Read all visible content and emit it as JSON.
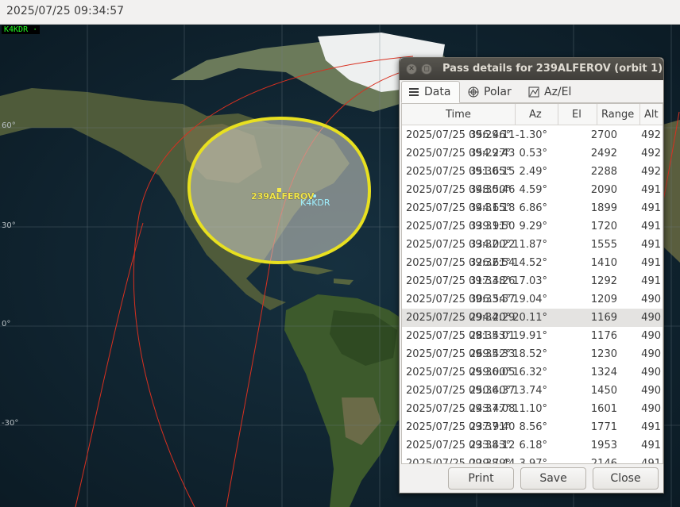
{
  "clock": "2025/07/25 09:34:57",
  "map": {
    "qth_badge": "K4KDR ·",
    "lat_labels": [
      "60°",
      "30°",
      "0°",
      "-30°"
    ],
    "satellite_label": "239ALFEROV",
    "qth_label": "K4KDR",
    "footprint_color": "#e8e020",
    "track_color": "#d83020"
  },
  "dialog": {
    "title": "Pass details for 239ALFEROV (orbit 1)",
    "tabs": [
      {
        "label": "Data",
        "icon": "list-icon"
      },
      {
        "label": "Polar",
        "icon": "polar-icon"
      },
      {
        "label": "Az/El",
        "icon": "chart-icon"
      }
    ],
    "columns": [
      "Time",
      "Az",
      "El",
      "Range",
      "Alt"
    ],
    "rows": [
      [
        "2025/07/25 09:29:11",
        "356.46°",
        "-1.30°",
        "2700",
        "492"
      ],
      [
        "2025/07/25 09:29:43",
        "354.27°",
        "0.53°",
        "2492",
        "492"
      ],
      [
        "2025/07/25 09:30:15",
        "351.65°",
        "2.49°",
        "2288",
        "492"
      ],
      [
        "2025/07/25 09:30:46",
        "348.50°",
        "4.59°",
        "2090",
        "491"
      ],
      [
        "2025/07/25 09:31:18",
        "344.65°",
        "6.86°",
        "1899",
        "491"
      ],
      [
        "2025/07/25 09:31:50",
        "339.91°",
        "9.29°",
        "1720",
        "491"
      ],
      [
        "2025/07/25 09:32:22",
        "334.00°",
        "11.87°",
        "1555",
        "491"
      ],
      [
        "2025/07/25 09:32:54",
        "326.61°",
        "14.52°",
        "1410",
        "491"
      ],
      [
        "2025/07/25 09:33:26",
        "317.48°",
        "17.03°",
        "1292",
        "491"
      ],
      [
        "2025/07/25 09:33:57",
        "306.54°",
        "19.04°",
        "1209",
        "490"
      ],
      [
        "2025/07/25 09:34:29",
        "294.20°",
        "20.11°",
        "1169",
        "490"
      ],
      [
        "2025/07/25 09:35:01",
        "281.43°",
        "19.91°",
        "1176",
        "490"
      ],
      [
        "2025/07/25 09:35:33",
        "269.42°",
        "18.52°",
        "1230",
        "490"
      ],
      [
        "2025/07/25 09:36:05",
        "259.00°",
        "16.32°",
        "1324",
        "490"
      ],
      [
        "2025/07/25 09:36:37",
        "250.40°",
        "13.74°",
        "1450",
        "490"
      ],
      [
        "2025/07/25 09:37:08",
        "243.47°",
        "11.10°",
        "1601",
        "490"
      ],
      [
        "2025/07/25 09:37:40",
        "237.91°",
        "8.56°",
        "1771",
        "491"
      ],
      [
        "2025/07/25 09:38:12",
        "233.43°",
        "6.18°",
        "1953",
        "491"
      ],
      [
        "2025/07/25 09:38:44",
        "229.79°",
        "3.97°",
        "2146",
        "491"
      ]
    ],
    "selected_row": 10,
    "buttons": {
      "print": "Print",
      "save": "Save",
      "close": "Close"
    }
  }
}
